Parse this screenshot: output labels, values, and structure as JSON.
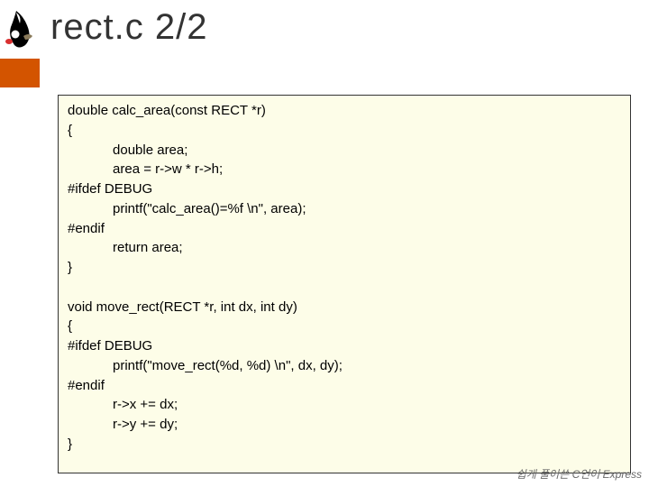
{
  "title": "rect.c 2/2",
  "code": "double calc_area(const RECT *r)\n{\n            double area;\n            area = r->w * r->h;\n#ifdef DEBUG\n            printf(\"calc_area()=%f \\n\", area);\n#endif\n            return area;\n}\n\nvoid move_rect(RECT *r, int dx, int dy)\n{\n#ifdef DEBUG\n            printf(\"move_rect(%d, %d) \\n\", dx, dy);\n#endif\n            r->x += dx;\n            r->y += dy;\n}",
  "footer": "쉽게 풀어쓴 C언어 Express"
}
